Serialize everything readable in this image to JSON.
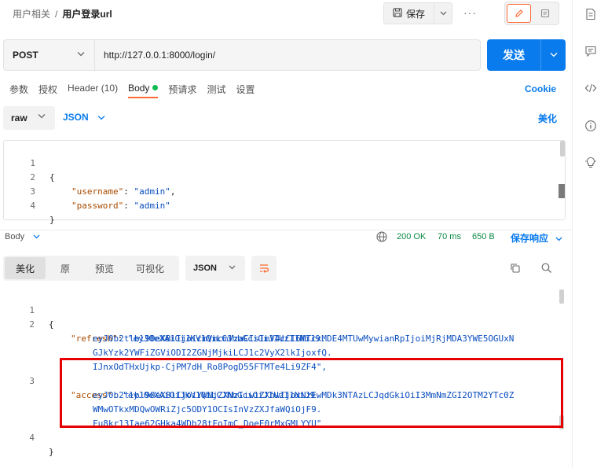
{
  "breadcrumb": {
    "parent": "用户相关",
    "separator": "/",
    "current": "用户登录url"
  },
  "toolbar": {
    "save_label": "保存",
    "more_label": "···"
  },
  "request": {
    "method": "POST",
    "url": "http://127.0.0.1:8000/login/",
    "send_label": "发送"
  },
  "tabs": [
    {
      "label": "参数"
    },
    {
      "label": "授权"
    },
    {
      "label": "Header (10)"
    },
    {
      "label": "Body"
    },
    {
      "label": "预请求"
    },
    {
      "label": "测试"
    },
    {
      "label": "设置"
    }
  ],
  "cookie_label": "Cookie",
  "body_type": {
    "mode": "raw",
    "format": "JSON",
    "beautify_label": "美化"
  },
  "request_body": {
    "lines": [
      {
        "n": "1",
        "open": "{"
      },
      {
        "n": "2",
        "key": "\"username\"",
        "colon": ": ",
        "value": "\"admin\"",
        "tail": ","
      },
      {
        "n": "3",
        "key": "\"password\"",
        "colon": ": ",
        "value": "\"admin\"",
        "tail": ""
      },
      {
        "n": "4",
        "open": "}"
      }
    ]
  },
  "response": {
    "body_label": "Body",
    "status": "200 OK",
    "time": "70 ms",
    "size": "650 B",
    "save_label": "保存响应",
    "view_tabs": [
      {
        "label": "美化"
      },
      {
        "label": "原"
      },
      {
        "label": "预览"
      },
      {
        "label": "可视化"
      }
    ],
    "format": "JSON",
    "lines": {
      "l1_num": "1",
      "l1_text": "{",
      "l2_num": "2",
      "refresh_key": "\"refresh\"",
      "refresh_colon": ": ",
      "refresh_v1": "\"eyJ0eXAiOiJKV1QiLCJhbGciOiJIUzI1NiJ9.",
      "refresh_v2": "eyJ0b2tlbl90eXBlIjoicmVmcmVzaCIsImV4cCI6MTcxMDE4MTUwMywianRpIjoiMjRjMDA3YWE5OGUxN",
      "refresh_v3": "GJkYzk2YWFiZGViODI2ZGNjMjkiLCJ1c2VyX2lkIjoxfQ.",
      "refresh_v4": "IJnxOdTHxUjkp-CjPM7dH_Ro8PogD55FTMTe4Li9ZF4\",",
      "l3_num": "3",
      "access_key": "\"access\"",
      "access_colon": ": ",
      "access_v1": "\"eyJ0eXAiOiJKV1QiLCJhbGciOiJIUzI1NiJ9.",
      "access_v2": "eyJ0b2tlbl90eXBlIjoiYWNjZXNzIiwiZXhwIjoxNzEwMDk3NTAzLCJqdGkiOiI3MmNmZGI2OTM2YTc0Z",
      "access_v3": "WMwOTkxMDQwOWRiZjc5ODY1OCIsInVzZXJfaWQiOjF9.",
      "access_v4": "Fu8kr13Iae62GHka4WDb28tFoImC_DoeE0rMxGMLYYU\"",
      "l4_num": "4",
      "l4_text": "}"
    }
  },
  "colors": {
    "accent": "#097bed",
    "brand": "#ff6c37",
    "success": "#0cbb52",
    "highlight": "#e60000"
  }
}
